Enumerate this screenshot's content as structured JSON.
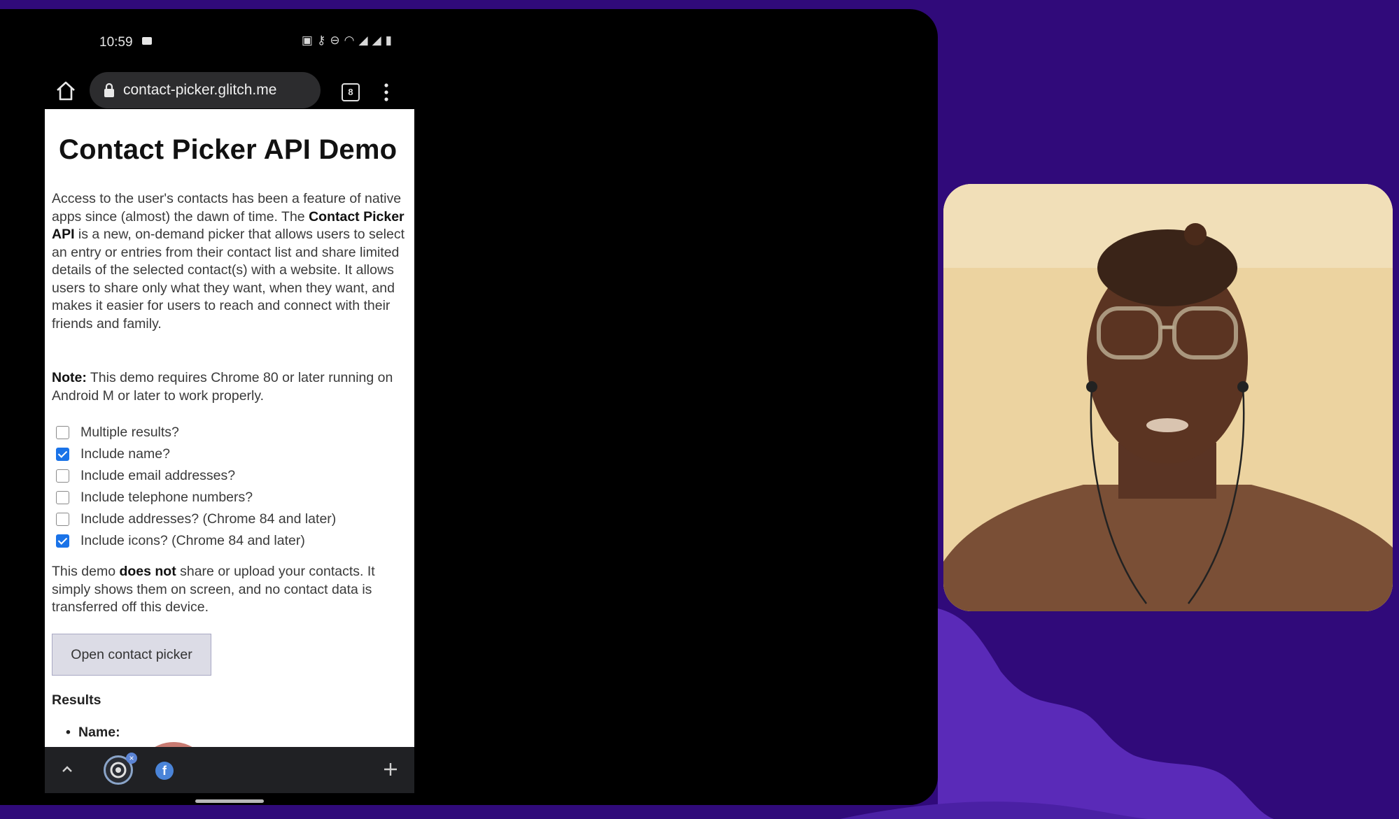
{
  "status_bar": {
    "time": "10:59"
  },
  "browser": {
    "url": "contact-picker.glitch.me",
    "tab_count": "8"
  },
  "page": {
    "title": "Contact Picker API Demo",
    "intro": {
      "part1": "Access to the user's contacts has been a feature of native apps since (almost) the dawn of time. The ",
      "bold": "Contact Picker API",
      "part2": " is a new, on-demand picker that allows users to select an entry or entries from their contact list and share limited details of the selected contact(s) with a website. It allows users to share only what they want, when they want, and makes it easier for users to reach and connect with their friends and family."
    },
    "note": {
      "bold": "Note:",
      "text": " This demo requires Chrome 80 or later running on Android M or later to work properly."
    },
    "options": [
      {
        "label": "Multiple results?",
        "checked": false
      },
      {
        "label": "Include name?",
        "checked": true
      },
      {
        "label": "Include email addresses?",
        "checked": false
      },
      {
        "label": "Include telephone numbers?",
        "checked": false
      },
      {
        "label": "Include addresses? (Chrome 84 and later)",
        "checked": false
      },
      {
        "label": "Include icons? (Chrome 84 and later)",
        "checked": true
      }
    ],
    "privacy": {
      "part1": "This demo ",
      "bold": "does not",
      "part2": " share or upload your contacts. It simply shows them on screen, and no contact data is transferred off this device."
    },
    "open_button": "Open contact picker",
    "results_heading": "Results",
    "results_items": [
      "Name:"
    ]
  },
  "bottom_bar": {
    "fb_tab_glyph": "f",
    "close_glyph": "×"
  },
  "colors": {
    "background_purple": "#300a7a",
    "accent_blue": "#1a73e8"
  }
}
